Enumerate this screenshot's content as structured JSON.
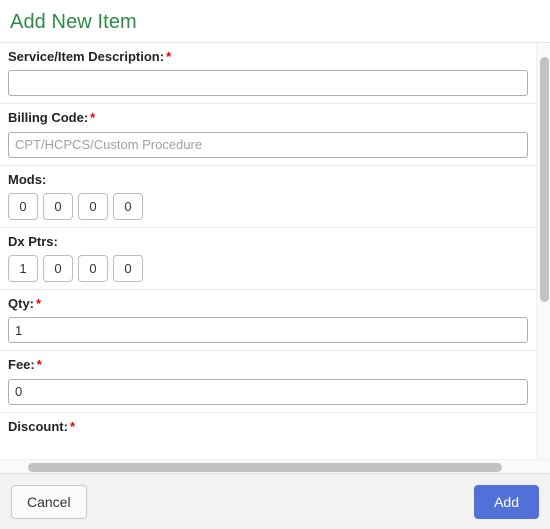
{
  "modal": {
    "title": "Add New Item"
  },
  "form": {
    "fields": [
      {
        "name": "service-item-description",
        "label": "Service/Item Description:",
        "required_marker": "*",
        "type": "text",
        "value": "",
        "placeholder": ""
      },
      {
        "name": "billing-code",
        "label": "Billing Code:",
        "required_marker": "*",
        "type": "text",
        "value": "",
        "placeholder": "CPT/HCPCS/Custom Procedure"
      },
      {
        "name": "mods",
        "label": "Mods:",
        "required_marker": "",
        "type": "mini-group",
        "values": [
          "0",
          "0",
          "0",
          "0"
        ]
      },
      {
        "name": "dx-ptrs",
        "label": "Dx Ptrs:",
        "required_marker": "",
        "type": "mini-group",
        "values": [
          "1",
          "0",
          "0",
          "0"
        ]
      },
      {
        "name": "qty",
        "label": "Qty:",
        "required_marker": "*",
        "type": "text",
        "value": "1",
        "placeholder": ""
      },
      {
        "name": "fee",
        "label": "Fee:",
        "required_marker": "*",
        "type": "text",
        "value": "0",
        "placeholder": ""
      },
      {
        "name": "discount",
        "label": "Discount:",
        "required_marker": "*",
        "type": "label-only",
        "value": "",
        "placeholder": ""
      }
    ]
  },
  "footer": {
    "cancel_label": "Cancel",
    "add_label": "Add"
  },
  "colors": {
    "title_green": "#2e8b45",
    "required_red": "#f00000",
    "primary_blue": "#5171d8",
    "footer_bg": "#f2f2f2",
    "scrollbar_thumb": "#c2c2c2"
  }
}
